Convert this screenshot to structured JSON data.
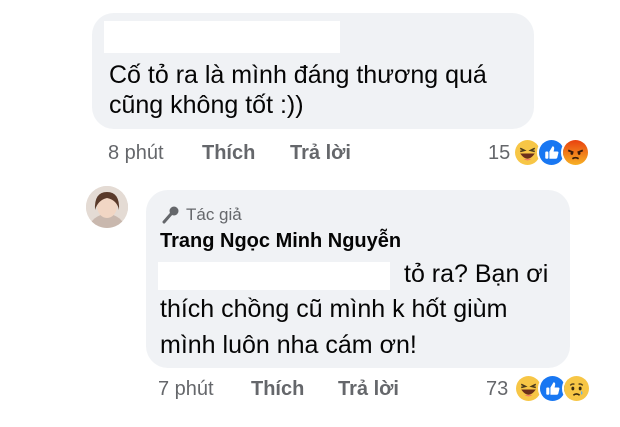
{
  "comment1": {
    "text_line1": "Cố tỏ ra là mình đáng thương quá",
    "text_line2": "cũng không tốt :))",
    "time": "8 phút",
    "like_label": "Thích",
    "reply_label": "Trả lời",
    "reaction_count": "15",
    "reactions": [
      "haha-icon",
      "like-icon",
      "angry-icon"
    ]
  },
  "comment2": {
    "author_badge": "Tác giả",
    "author_name": "Trang Ngọc Minh Nguyễn",
    "text_line1": "tỏ ra? Bạn ơi",
    "text_line2": "thích chồng cũ mình k hốt giùm",
    "text_line3": "mình luôn nha cám ơn!",
    "time": "7 phút",
    "like_label": "Thích",
    "reply_label": "Trả lời",
    "reaction_count": "73",
    "reactions": [
      "haha-icon",
      "like-icon",
      "sad-icon"
    ]
  },
  "colors": {
    "bubble": "#f0f2f5",
    "meta": "#65676b",
    "like_blue": "#1877f2",
    "haha_yellow": "#f7c646",
    "angry_red": "#e9710f"
  }
}
